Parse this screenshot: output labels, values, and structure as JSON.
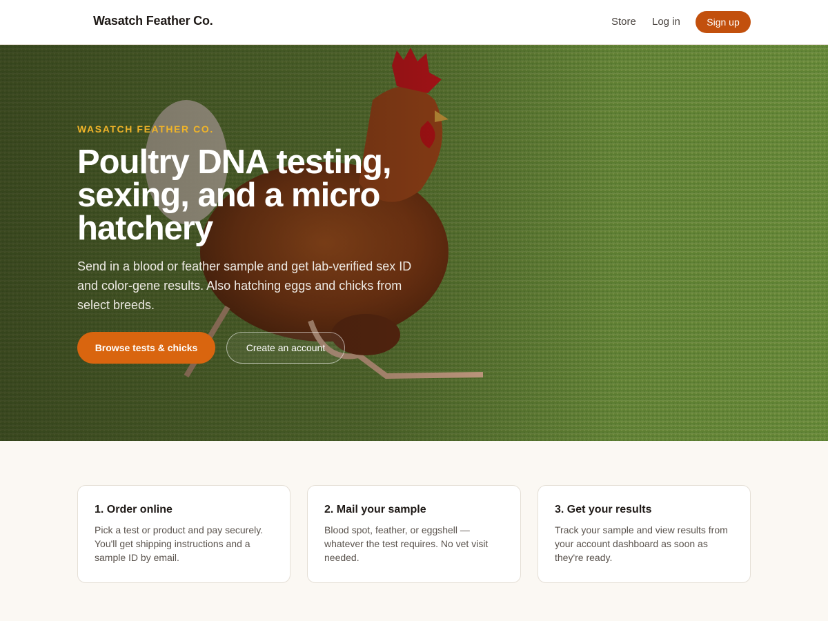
{
  "header": {
    "brand": "Wasatch Feather Co.",
    "nav": [
      "Store",
      "Log in"
    ],
    "signup_label": "Sign up"
  },
  "hero": {
    "eyebrow": "WASATCH FEATHER CO.",
    "title": "Poultry DNA testing, sexing, and a micro hatchery",
    "subtitle": "Send in a blood or feather sample and get lab-verified sex ID and color-gene results. Also hatching eggs and chicks from select breeds.",
    "primary_cta": "Browse tests & chicks",
    "secondary_cta": "Create an account",
    "background_image": "hen-walking-on-grass"
  },
  "steps": [
    {
      "title": "1. Order online",
      "body": "Pick a test or product and pay securely. You'll get shipping instructions and a sample ID by email."
    },
    {
      "title": "2. Mail your sample",
      "body": "Blood spot, feather, or eggshell — whatever the test requires. No vet visit needed."
    },
    {
      "title": "3. Get your results",
      "body": "Track your sample and view results from your account dashboard as soon as they're ready."
    }
  ],
  "colors": {
    "accent": "#c2500d",
    "cta": "#d9650f",
    "eyebrow": "#f0b429",
    "page_bg": "#fbf8f3"
  }
}
